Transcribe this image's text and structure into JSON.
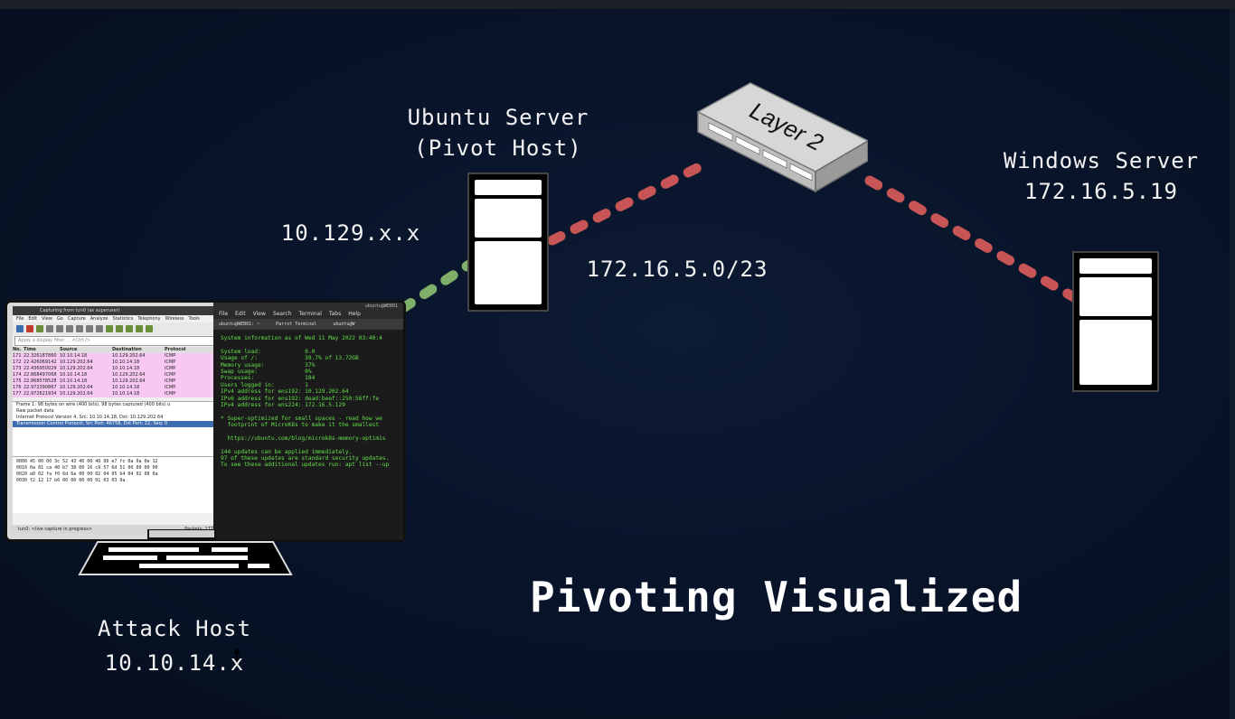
{
  "title": "Pivoting Visualized",
  "nodes": {
    "ubuntu": {
      "line1": "Ubuntu Server",
      "line2": "(Pivot Host)"
    },
    "switch": {
      "label": "Layer 2"
    },
    "windows": {
      "line1": "Windows Server",
      "line2": "172.16.5.19"
    },
    "attack": {
      "line1": "Attack Host",
      "line2": "10.10.14.x"
    }
  },
  "networks": {
    "external": "10.129.x.x",
    "internal": "172.16.5.0/23"
  },
  "colors": {
    "external_link": "#7fb069",
    "internal_link": "#c75555",
    "background": "#081326"
  },
  "wireshark": {
    "title": "Capturing from tun0 (as superuser)",
    "menu": [
      "File",
      "Edit",
      "View",
      "Go",
      "Capture",
      "Analyze",
      "Statistics",
      "Telephony",
      "Wireless",
      "Tools"
    ],
    "filter_placeholder": "Apply a display filter ... <Ctrl-/>",
    "columns": [
      "No.",
      "Time",
      "Source",
      "Destination",
      "Protocol"
    ],
    "rows": [
      [
        "171",
        "22.326187860",
        "10.10.14.18",
        "10.129.202.64",
        "ICMP"
      ],
      [
        "172",
        "22.426069142",
        "10.129.202.64",
        "10.10.14.18",
        "ICMP"
      ],
      [
        "173",
        "22.436950029",
        "10.129.202.64",
        "10.10.14.18",
        "ICMP"
      ],
      [
        "174",
        "22.868497068",
        "10.10.14.18",
        "10.129.202.64",
        "ICMP"
      ],
      [
        "175",
        "22.868578528",
        "10.10.14.18",
        "10.129.202.64",
        "ICMP"
      ],
      [
        "176",
        "22.972390867",
        "10.129.202.64",
        "10.10.14.18",
        "ICMP"
      ],
      [
        "177",
        "22.972621934",
        "10.129.202.64",
        "10.10.14.18",
        "ICMP"
      ]
    ],
    "details": [
      "Frame 1: 98 bytes on wire (400 bits), 98 bytes captured (400 bits) o",
      "Raw packet data",
      "Internet Protocol Version 4, Src: 10.10.14.18, Dst: 10.129.202.64",
      "Transmission Control Protocol, Src Port: 46758, Dst Port: 22, Seq: 0"
    ],
    "hex": [
      "0000  45 00 00 3c 52 43 40 00  40 06 e7 fc 0a 0a 0e 12",
      "0010  0a 81 ca 40 b7 38 00 16  c9 57 6d 51 00 00 00 00",
      "0020  a0 02 fa f0 6d 6a 00 00  02 04 05 b4 04 02 08 0a",
      "0030  f2 12 17 b6 00 00 00 00  01 03 03 0a"
    ],
    "status_left": "tun0: <live capture in progress>",
    "status_right": "Packets: 177"
  },
  "terminal": {
    "title": "ubuntu@WEB01",
    "menu": [
      "File",
      "Edit",
      "View",
      "Search",
      "Terminal",
      "Tabs",
      "Help"
    ],
    "tabs": [
      "ubuntu@WEB01: ~",
      "Parrot Terminal",
      "ubuntu@W"
    ],
    "lines": [
      "System information as of Wed 11 May 2022 03:40:4",
      "",
      "System load:             0.0",
      "Usage of /:              39.7% of 13.72GB",
      "Memory usage:            37%",
      "Swap usage:              0%",
      "Processes:               184",
      "Users logged in:         1",
      "IPv4 address for ens192: 10.129.202.64",
      "IPv6 address for ens192: dead:beef::250:56ff:fe",
      "IPv4 address for ens224: 172.16.5.129",
      "",
      "* Super-optimized for small spaces - read how we",
      "  footprint of MicroK8s to make it the smallest",
      "",
      "  https://ubuntu.com/blog/microk8s-memory-optimis",
      "",
      "144 updates can be applied immediately.",
      "97 of these updates are standard security updates.",
      "To see these additional updates run: apt list --up"
    ]
  }
}
